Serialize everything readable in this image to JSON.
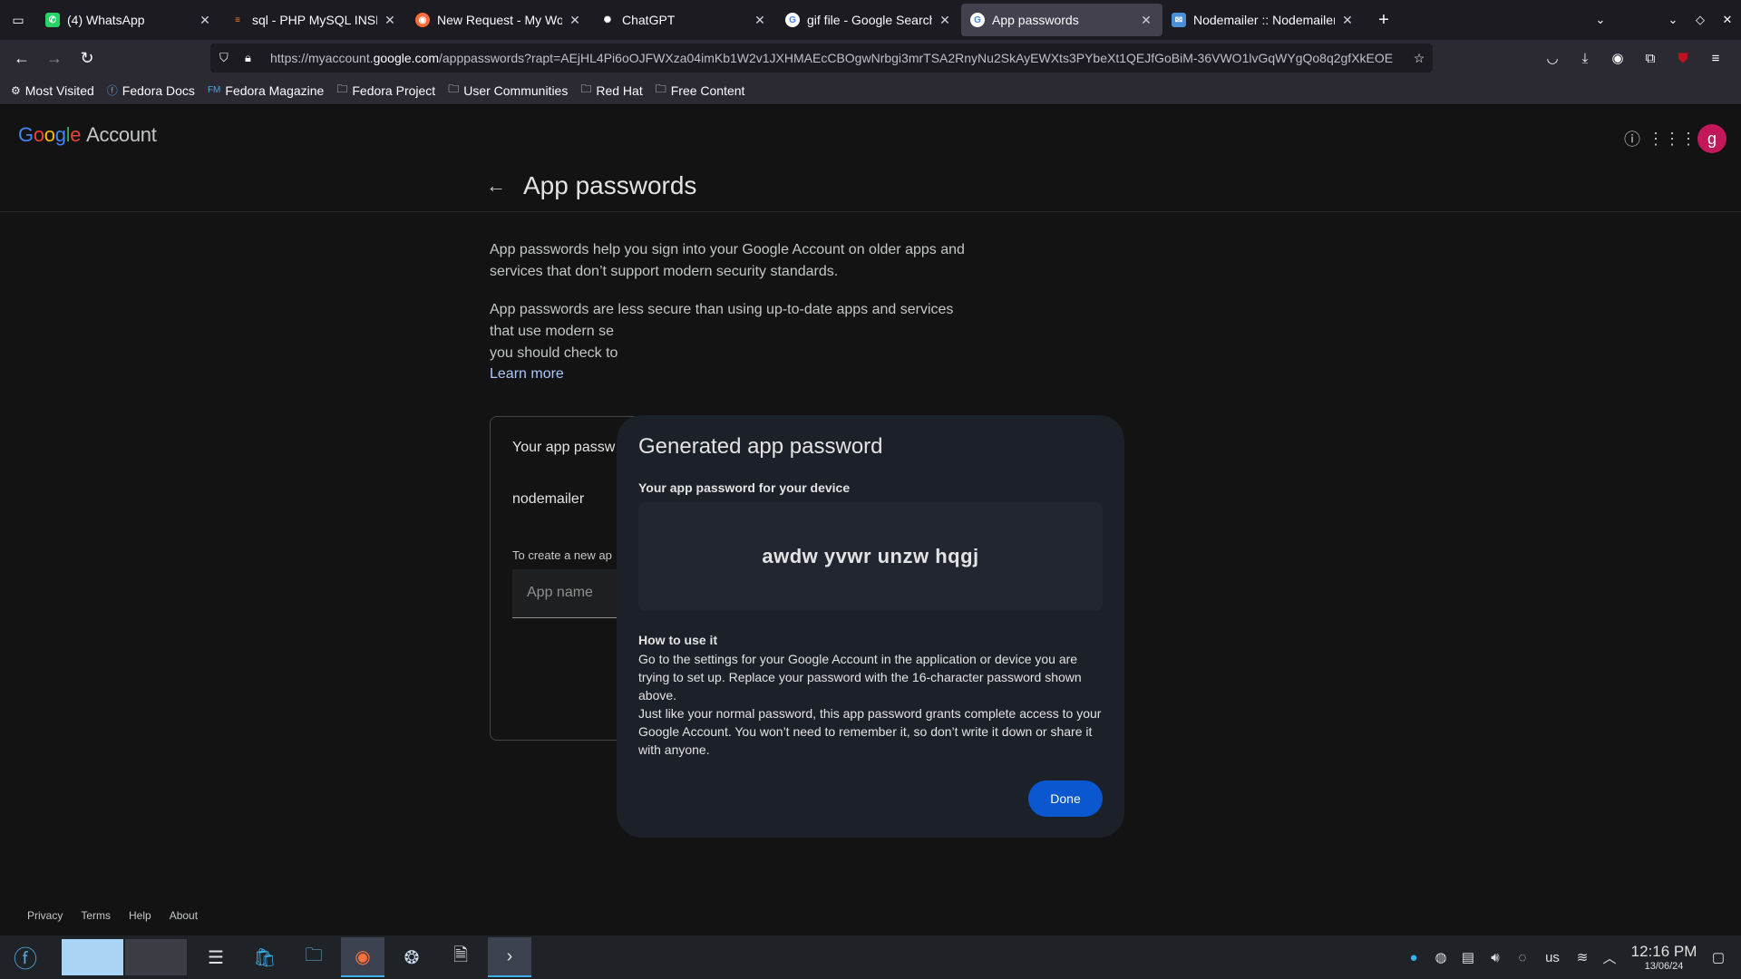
{
  "browser": {
    "tabs": [
      {
        "title": "(4) WhatsApp",
        "icon": "whatsapp-icon",
        "color": "#25d366"
      },
      {
        "title": "sql - PHP MySQL INSERT re",
        "icon": "stackoverflow-icon",
        "color": "#f48024"
      },
      {
        "title": "New Request - My Worksp",
        "icon": "postman-icon",
        "color": "#ff6c37"
      },
      {
        "title": "ChatGPT",
        "icon": "chatgpt-icon",
        "color": "#ffffff"
      },
      {
        "title": "gif file - Google Search",
        "icon": "google-icon",
        "color": "#ffffff"
      },
      {
        "title": "App passwords",
        "icon": "google-icon",
        "color": "#ffffff",
        "active": true
      },
      {
        "title": "Nodemailer :: Nodemailer",
        "icon": "nodemailer-icon",
        "color": "#4a90d9"
      }
    ],
    "url_prefix": "https://myaccount.",
    "url_domain": "google.com",
    "url_rest": "/apppasswords?rapt=AEjHL4Pi6oOJFWXza04imKb1W2v1JXHMAEcCBOgwNrbgi3mrTSA2RnyNu2SkAyEWXts3PYbeXt1QEJfGoBiM-36VWO1lvGqWYgQo8q2gfXkEOE",
    "bookmarks": [
      {
        "label": "Most Visited",
        "icon": "gear-icon"
      },
      {
        "label": "Fedora Docs",
        "icon": "fedora-icon"
      },
      {
        "label": "Fedora Magazine",
        "icon": "fedora-magazine-icon"
      },
      {
        "label": "Fedora Project",
        "icon": "folder-icon"
      },
      {
        "label": "User Communities",
        "icon": "folder-icon"
      },
      {
        "label": "Red Hat",
        "icon": "folder-icon"
      },
      {
        "label": "Free Content",
        "icon": "folder-icon"
      }
    ]
  },
  "page": {
    "logo": "Google",
    "logo_suffix": "Account",
    "avatar_letter": "g",
    "title": "App passwords",
    "para1": "App passwords help you sign into your Google Account on older apps and services that don’t support modern security standards.",
    "para2_l1": "App passwords are less secure than using up-to-date apps and services",
    "para2_l2": "that use modern se",
    "para2_l3": "you should check to",
    "learn_more": "Learn more",
    "card_title": "Your app passw",
    "app_entry": "nodemailer",
    "create_hint": "To create a new ap",
    "input_placeholder": "App name",
    "footer": [
      "Privacy",
      "Terms",
      "Help",
      "About"
    ]
  },
  "dialog": {
    "title": "Generated app password",
    "subtitle": "Your app password for your device",
    "password": "awdw yvwr unzw hqgj",
    "how_title": "How to use it",
    "how_p1": "Go to the settings for your Google Account in the application or device you are trying to set up. Replace your password with the 16-character password shown above.",
    "how_p2": "Just like your normal password, this app password grants complete access to your Google Account. You won’t need to remember it, so don’t write it down or share it with anyone.",
    "done": "Done"
  },
  "taskbar": {
    "keyboard_layout": "us",
    "time": "12:16 PM",
    "date": "13/06/24"
  }
}
